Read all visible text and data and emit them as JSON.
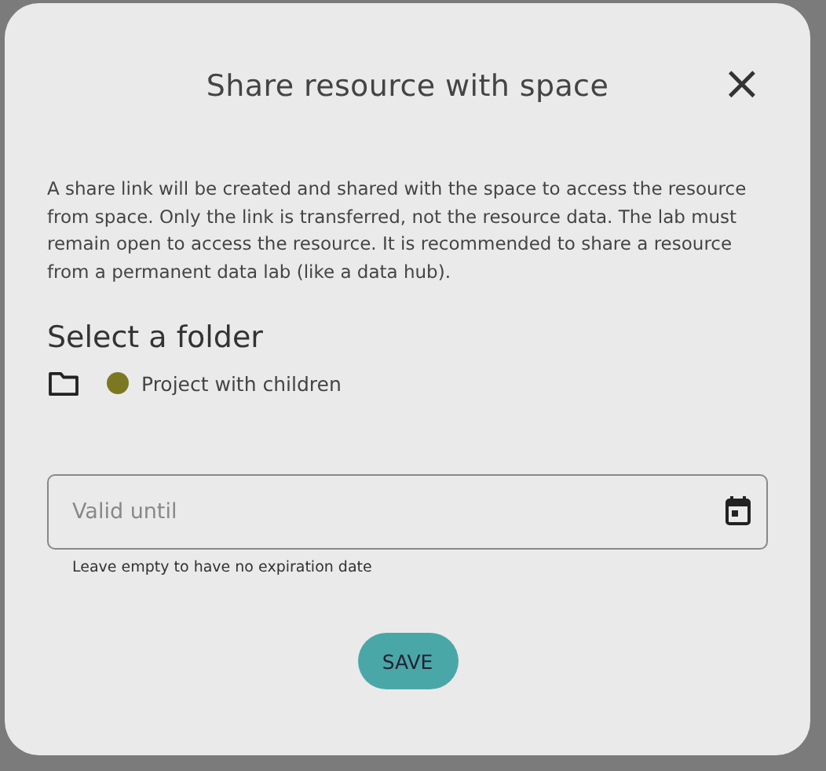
{
  "dialog": {
    "title": "Share resource with space",
    "close": "×",
    "description": "A share link will be created and shared with the space to access the resource from space. Only the link is transferred, not the resource data. The lab must remain open to access the resource. It is recommended to share a resource from a permanent data lab (like a data hub).",
    "folder_heading": "Select a folder",
    "folder": {
      "name": "Project with children",
      "color": "#7c7822"
    },
    "valid_until": {
      "placeholder": "Valid until",
      "hint": "Leave empty to have no expiration date"
    },
    "buttons": [
      "SAVE"
    ]
  }
}
